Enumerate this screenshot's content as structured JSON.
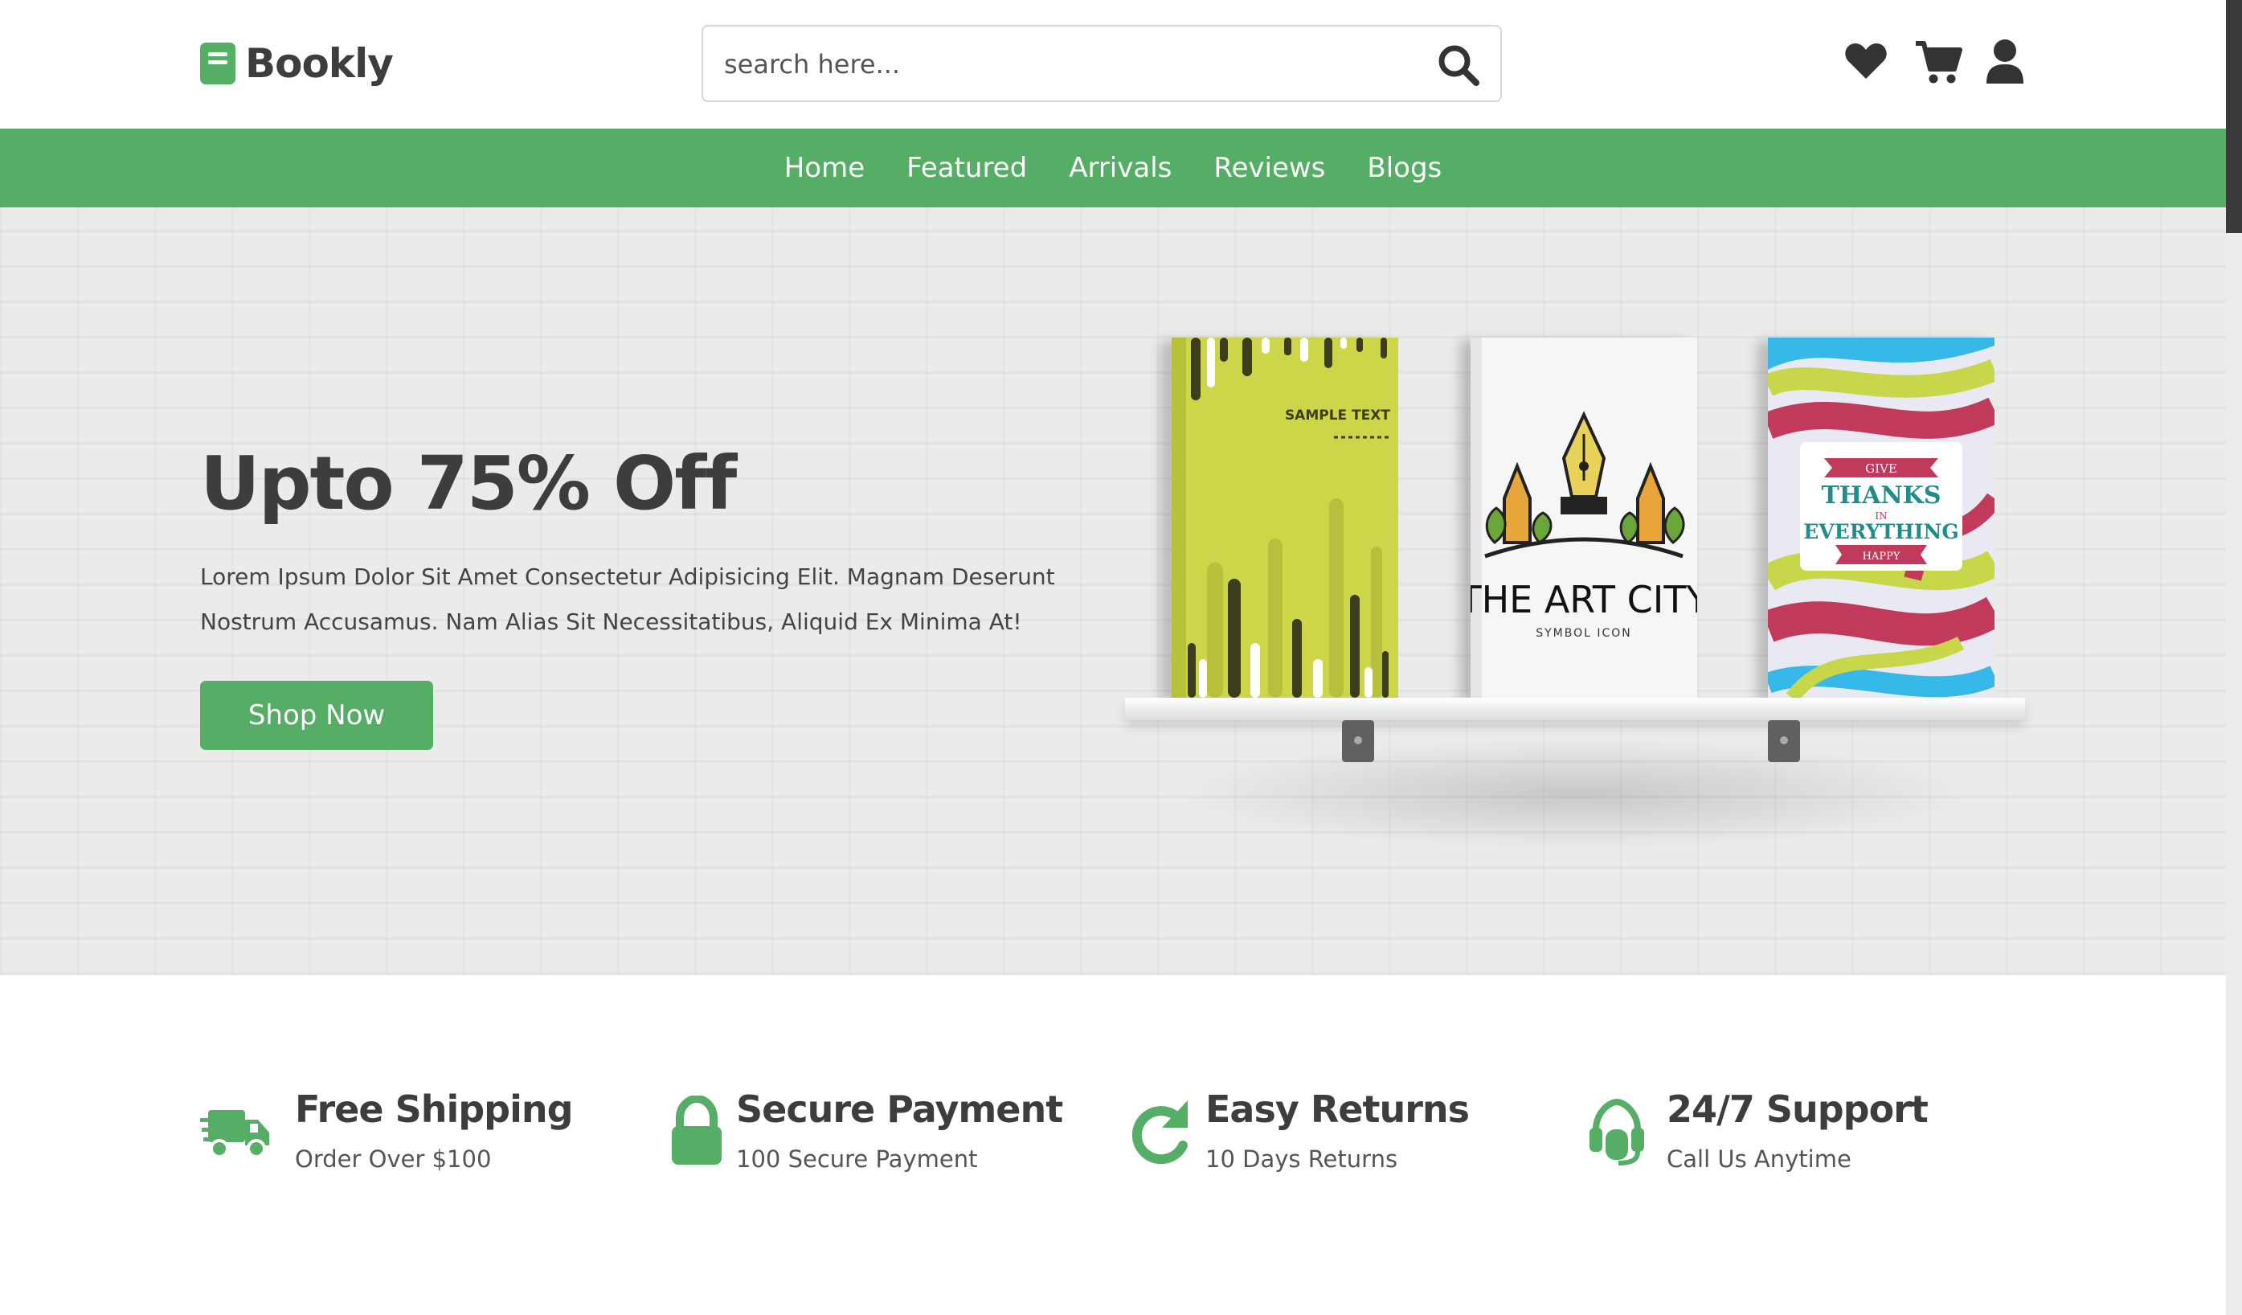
{
  "header": {
    "logo_text": "Bookly",
    "search_placeholder": "search here..."
  },
  "nav": {
    "items": [
      "Home",
      "Featured",
      "Arrivals",
      "Reviews",
      "Blogs"
    ]
  },
  "hero": {
    "title": "Upto 75% Off",
    "description": "Lorem Ipsum Dolor Sit Amet Consectetur Adipisicing Elit. Magnam Deserunt Nostrum Accusamus. Nam Alias Sit Necessitatibus, Aliquid Ex Minima At!",
    "button": "Shop Now",
    "books": [
      {
        "cover_text": "SAMPLE TEXT"
      },
      {
        "title": "THE ART CITY",
        "subtitle": "SYMBOL ICON"
      },
      {
        "lines": [
          "GIVE",
          "THANKS",
          "IN",
          "EVERYTHING",
          "HAPPY"
        ]
      }
    ]
  },
  "features": [
    {
      "icon": "truck-icon",
      "title": "Free Shipping",
      "subtitle": "Order Over $100"
    },
    {
      "icon": "lock-icon",
      "title": "Secure Payment",
      "subtitle": "100 Secure Payment"
    },
    {
      "icon": "redo-icon",
      "title": "Easy Returns",
      "subtitle": "10 Days Returns"
    },
    {
      "icon": "headset-icon",
      "title": "24/7 Support",
      "subtitle": "Call Us Anytime"
    }
  ],
  "colors": {
    "accent": "#55ad66",
    "text_dark": "#3d3d3d",
    "hero_bg": "#ebebeb"
  }
}
